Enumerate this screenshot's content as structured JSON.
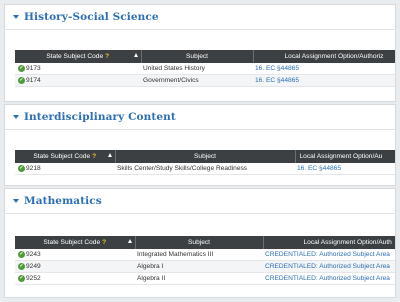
{
  "sections": [
    {
      "title": "History-Social Science",
      "headers": [
        "State Subject Code",
        "Subject",
        "Local Assignment Option/Authoriz"
      ],
      "rows": [
        {
          "code": "9173",
          "subject": "United States History",
          "option": "16. EC §44865"
        },
        {
          "code": "9174",
          "subject": "Government/Civics",
          "option": "16. EC §44865"
        }
      ]
    },
    {
      "title": "Interdisciplinary Content",
      "headers": [
        "State Subject Code",
        "Subject",
        "Local Assignment Option/Au"
      ],
      "rows": [
        {
          "code": "9218",
          "subject": "Skills Center/Study Skills/College Readiness",
          "option": "16. EC §44865"
        }
      ]
    },
    {
      "title": "Mathematics",
      "headers": [
        "State Subject Code",
        "Subject",
        "Local Assignment Option/Auth"
      ],
      "rows": [
        {
          "code": "9243",
          "subject": "Integrated Mathematics III",
          "option": "CREDENTIALED: Authorized Subject Area"
        },
        {
          "code": "9249",
          "subject": "Algebra I",
          "option": "CREDENTIALED: Authorized Subject Area"
        },
        {
          "code": "9252",
          "subject": "Algebra II",
          "option": "CREDENTIALED: Authorized Subject Area"
        }
      ]
    }
  ],
  "ui": {
    "help_mark": "?",
    "badge_glyph": "✓"
  },
  "colors": {
    "accent": "#2c6fb3",
    "header_bg": "#3c4043",
    "badge": "#4f9a3a",
    "help": "#f1c232"
  }
}
